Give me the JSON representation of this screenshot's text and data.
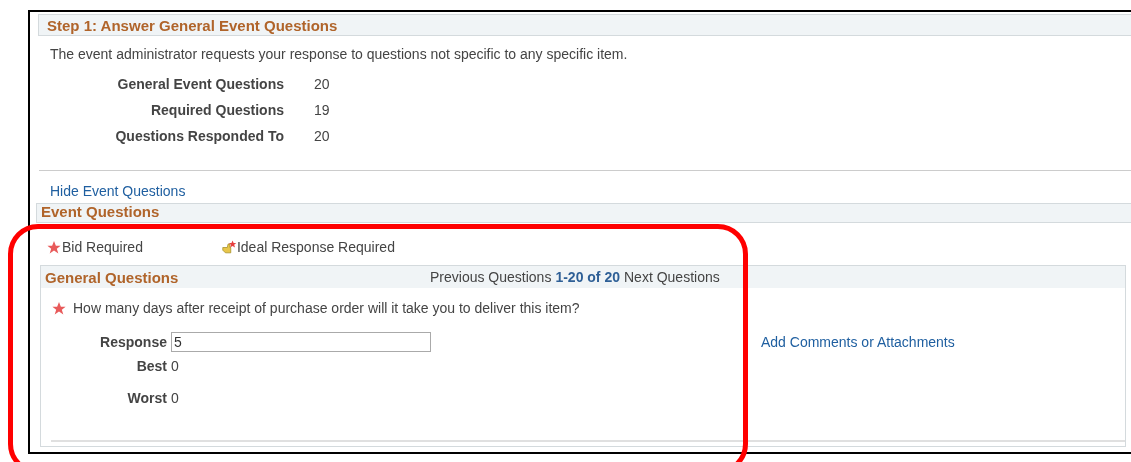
{
  "step_header": "Step 1: Answer General Event Questions",
  "intro": "The event administrator requests your response to questions not specific to any specific item.",
  "stats": [
    {
      "label": "General Event Questions",
      "value": "20"
    },
    {
      "label": "Required Questions",
      "value": "19"
    },
    {
      "label": "Questions Responded To",
      "value": "20"
    }
  ],
  "hide_link": "Hide Event Questions",
  "event_questions_header": "Event Questions",
  "legend": [
    {
      "kind": "bid",
      "label": "Bid Required"
    },
    {
      "kind": "ideal",
      "label": "Ideal Response Required"
    }
  ],
  "general_questions": {
    "title": "General Questions",
    "prev": "Previous Questions",
    "range": "1-20 of 20",
    "next": "Next Questions",
    "question": {
      "required": true,
      "text": "How many days after receipt of purchase order will it take you to deliver this item?",
      "response_label": "Response",
      "response": "5",
      "best_label": "Best",
      "best": "0",
      "worst_label": "Worst",
      "worst": "0",
      "comments_link": "Add Comments or Attachments"
    }
  }
}
